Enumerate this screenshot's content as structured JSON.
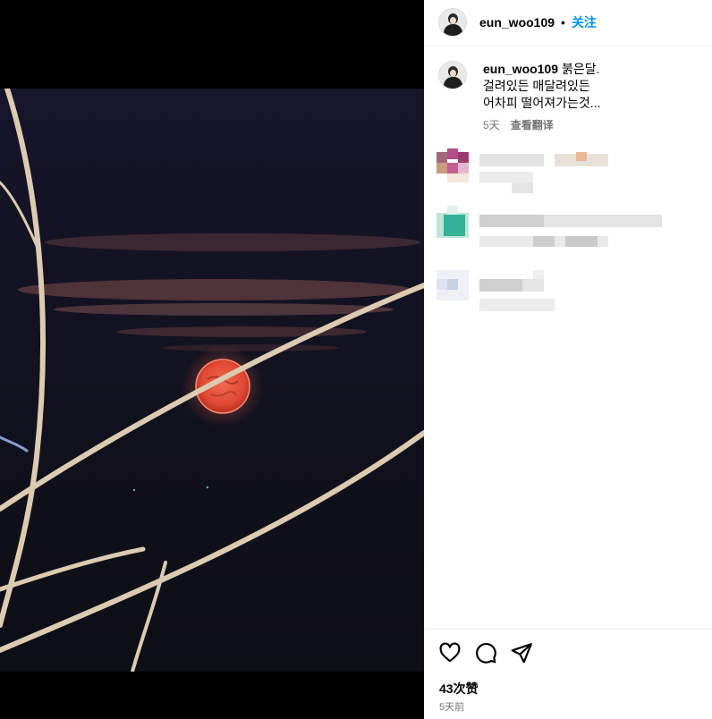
{
  "post": {
    "username": "eun_woo109",
    "separator": "•",
    "follow_label": "关注",
    "caption_user": "eun_woo109",
    "caption_lines": [
      "붉은달.",
      "걸려있든 매달려있든",
      "어차피 떨어져가는것..."
    ],
    "caption_age": "5天",
    "translate_label": "查看翻译",
    "likes": "43次赞",
    "posted_ago": "5天前"
  },
  "icons": {
    "like": "heart-icon",
    "comment": "comment-icon",
    "share": "share-icon"
  },
  "colors": {
    "accent": "#0095f6",
    "moon": "#e5553f",
    "sky": "#13121d",
    "branch": "#d9c7ad"
  }
}
